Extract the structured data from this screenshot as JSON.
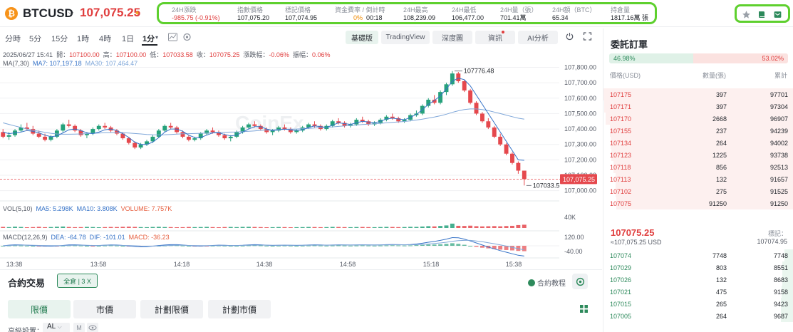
{
  "header": {
    "coin_symbol": "₿",
    "symbol": "BTCUSD",
    "last_price": "107,075.25",
    "stats": [
      {
        "label": "24H漲跌",
        "value": "-985.75 (-0.91%)",
        "tone": "red"
      },
      {
        "label": "指數價格",
        "value": "107,075.20",
        "tone": "normal"
      },
      {
        "label": "標記價格",
        "value": "107,074.95",
        "tone": "normal"
      },
      {
        "label": "資金費率 / 倒計時",
        "value_rate": "0%",
        "value_countdown": "00:18",
        "tone": "mixed"
      },
      {
        "label": "24H最高",
        "value": "108,239.09",
        "tone": "normal"
      },
      {
        "label": "24H最低",
        "value": "106,477.00",
        "tone": "normal"
      },
      {
        "label": "24H量（張）",
        "value": "701.41萬",
        "tone": "normal"
      },
      {
        "label": "24H額（BTC）",
        "value": "65.34",
        "tone": "normal"
      },
      {
        "label": "持倉量",
        "value": "1817.16萬 張",
        "tone": "normal"
      }
    ],
    "icons": [
      "star-icon",
      "book-icon",
      "mail-icon"
    ]
  },
  "toolbar": {
    "timeframes": [
      "分時",
      "5分",
      "15分",
      "1時",
      "4時",
      "1日",
      "1分"
    ],
    "active_timeframe": "1分",
    "views": [
      "基礎版",
      "TradingView",
      "深度圖",
      "資訊",
      "AI分析"
    ],
    "active_view": "基礎版"
  },
  "info": {
    "line1": {
      "date": "2025/06/27 15:41",
      "open_lbl": "開：",
      "open": "107100.00",
      "high_lbl": "高：",
      "high": "107100.00",
      "low_lbl": "低：",
      "low": "107033.58",
      "close_lbl": "收：",
      "close": "107075.25",
      "chg_lbl": "漲跌幅：",
      "chg": "-0.06%",
      "amp_lbl": "振幅：",
      "amp": "0.06%"
    },
    "ma_line": {
      "label": "MA(7,30)",
      "ma7": "MA7: 107,197.18",
      "ma30": "MA30: 107,464.47"
    },
    "vol_line": {
      "label": "VOL(5,10)",
      "ma5": "MA5: 5.298K",
      "ma10": "MA10: 3.808K",
      "volume": "VOLUME: 7.757K"
    },
    "macd_line": {
      "label": "MACD(12,26,9)",
      "dea": "DEA: -64.78",
      "dif": "DIF: -101.01",
      "macd": "MACD: -36.23"
    }
  },
  "chart_data": {
    "type": "candlestick",
    "watermark": "CoinEx",
    "price_axis": [
      "107,800.00",
      "107,700.00",
      "107,600.00",
      "107,500.00",
      "107,400.00",
      "107,300.00",
      "107,200.00",
      "107,100.00",
      "107,000.00"
    ],
    "ylim": [
      106980,
      107830
    ],
    "current_price_tag": "107,075.25",
    "max_label": "107776.48",
    "min_label": "107033.5",
    "volume_axis": [
      "40K"
    ],
    "macd_axis": [
      "120.00",
      "-40.00"
    ],
    "time_axis": [
      "13:38",
      "13:58",
      "14:18",
      "14:38",
      "14:58",
      "15:18",
      "15:38"
    ],
    "colors": {
      "up": "#26a17b",
      "down": "#e5484d",
      "ma7": "#3572c7",
      "ma30": "#7fa7d9",
      "grid": "#f0f1f3",
      "current_line": "#e5484d"
    },
    "candles_ohlc": [
      [
        107380,
        107400,
        107340,
        107350
      ],
      [
        107350,
        107380,
        107330,
        107360
      ],
      [
        107360,
        107400,
        107350,
        107390
      ],
      [
        107390,
        107430,
        107380,
        107410
      ],
      [
        107410,
        107440,
        107390,
        107400
      ],
      [
        107400,
        107420,
        107360,
        107370
      ],
      [
        107370,
        107390,
        107340,
        107350
      ],
      [
        107350,
        107370,
        107320,
        107330
      ],
      [
        107330,
        107360,
        107320,
        107350
      ],
      [
        107350,
        107400,
        107340,
        107390
      ],
      [
        107390,
        107440,
        107380,
        107430
      ],
      [
        107430,
        107460,
        107410,
        107420
      ],
      [
        107420,
        107430,
        107380,
        107390
      ],
      [
        107390,
        107400,
        107350,
        107360
      ],
      [
        107360,
        107380,
        107340,
        107370
      ],
      [
        107370,
        107410,
        107360,
        107400
      ],
      [
        107400,
        107430,
        107390,
        107420
      ],
      [
        107420,
        107440,
        107400,
        107410
      ],
      [
        107410,
        107420,
        107380,
        107390
      ],
      [
        107390,
        107400,
        107360,
        107370
      ],
      [
        107370,
        107380,
        107330,
        107340
      ],
      [
        107340,
        107350,
        107300,
        107310
      ],
      [
        107310,
        107320,
        107270,
        107280
      ],
      [
        107280,
        107310,
        107270,
        107300
      ],
      [
        107300,
        107330,
        107290,
        107320
      ],
      [
        107320,
        107360,
        107310,
        107350
      ],
      [
        107350,
        107400,
        107340,
        107390
      ],
      [
        107390,
        107430,
        107380,
        107420
      ],
      [
        107420,
        107440,
        107400,
        107410
      ],
      [
        107410,
        107420,
        107370,
        107380
      ],
      [
        107380,
        107390,
        107340,
        107350
      ],
      [
        107350,
        107360,
        107320,
        107330
      ],
      [
        107330,
        107350,
        107320,
        107340
      ],
      [
        107340,
        107380,
        107330,
        107370
      ],
      [
        107370,
        107400,
        107360,
        107390
      ],
      [
        107390,
        107410,
        107370,
        107380
      ],
      [
        107380,
        107390,
        107350,
        107360
      ],
      [
        107360,
        107370,
        107330,
        107340
      ],
      [
        107340,
        107360,
        107320,
        107350
      ],
      [
        107350,
        107390,
        107340,
        107380
      ],
      [
        107380,
        107420,
        107370,
        107410
      ],
      [
        107410,
        107440,
        107400,
        107430
      ],
      [
        107430,
        107450,
        107410,
        107420
      ],
      [
        107420,
        107430,
        107390,
        107400
      ],
      [
        107400,
        107410,
        107370,
        107380
      ],
      [
        107380,
        107400,
        107360,
        107390
      ],
      [
        107390,
        107420,
        107380,
        107410
      ],
      [
        107410,
        107430,
        107390,
        107400
      ],
      [
        107400,
        107410,
        107370,
        107380
      ],
      [
        107380,
        107400,
        107370,
        107390
      ],
      [
        107390,
        107420,
        107380,
        107410
      ],
      [
        107410,
        107440,
        107400,
        107430
      ],
      [
        107430,
        107450,
        107410,
        107420
      ],
      [
        107420,
        107430,
        107390,
        107400
      ],
      [
        107400,
        107430,
        107390,
        107420
      ],
      [
        107420,
        107460,
        107410,
        107450
      ],
      [
        107450,
        107470,
        107430,
        107440
      ],
      [
        107440,
        107450,
        107410,
        107420
      ],
      [
        107420,
        107440,
        107410,
        107430
      ],
      [
        107430,
        107470,
        107420,
        107460
      ],
      [
        107460,
        107480,
        107440,
        107450
      ],
      [
        107450,
        107460,
        107420,
        107430
      ],
      [
        107430,
        107450,
        107420,
        107440
      ],
      [
        107440,
        107470,
        107430,
        107460
      ],
      [
        107460,
        107490,
        107450,
        107480
      ],
      [
        107480,
        107500,
        107460,
        107470
      ],
      [
        107470,
        107480,
        107440,
        107450
      ],
      [
        107450,
        107470,
        107440,
        107460
      ],
      [
        107460,
        107500,
        107450,
        107490
      ],
      [
        107490,
        107520,
        107480,
        107500
      ],
      [
        107500,
        107560,
        107490,
        107550
      ],
      [
        107550,
        107600,
        107540,
        107590
      ],
      [
        107590,
        107620,
        107560,
        107570
      ],
      [
        107570,
        107650,
        107560,
        107640
      ],
      [
        107640,
        107700,
        107620,
        107690
      ],
      [
        107690,
        107776,
        107680,
        107760
      ],
      [
        107760,
        107770,
        107700,
        107710
      ],
      [
        107710,
        107720,
        107640,
        107650
      ],
      [
        107650,
        107660,
        107560,
        107570
      ],
      [
        107570,
        107580,
        107490,
        107500
      ],
      [
        107500,
        107510,
        107440,
        107450
      ],
      [
        107450,
        107470,
        107400,
        107410
      ],
      [
        107410,
        107420,
        107340,
        107350
      ],
      [
        107350,
        107370,
        107290,
        107300
      ],
      [
        107300,
        107310,
        107230,
        107240
      ],
      [
        107240,
        107250,
        107170,
        107180
      ],
      [
        107180,
        107190,
        107110,
        107130
      ],
      [
        107130,
        107100,
        107034,
        107075
      ]
    ],
    "ma7": [
      107380,
      107370,
      107375,
      107380,
      107390,
      107385,
      107375,
      107360,
      107350,
      107355,
      107375,
      107395,
      107400,
      107390,
      107375,
      107370,
      107380,
      107395,
      107400,
      107390,
      107370,
      107345,
      107315,
      107300,
      107300,
      107315,
      107345,
      107380,
      107400,
      107400,
      107385,
      107360,
      107345,
      107345,
      107360,
      107375,
      107375,
      107365,
      107355,
      107360,
      107380,
      107400,
      107415,
      107415,
      107400,
      107390,
      107395,
      107400,
      107395,
      107390,
      107395,
      107410,
      107420,
      107415,
      107410,
      107425,
      107440,
      107435,
      107430,
      107440,
      107450,
      107445,
      107440,
      107450,
      107465,
      107470,
      107465,
      107460,
      107475,
      107495,
      107525,
      107560,
      107585,
      107615,
      107660,
      107710,
      107730,
      107720,
      107680,
      107620,
      107560,
      107500,
      107440,
      107380,
      107320,
      107260,
      107200,
      107197
    ],
    "ma30": [
      107440,
      107430,
      107420,
      107410,
      107400,
      107392,
      107385,
      107378,
      107372,
      107368,
      107366,
      107366,
      107367,
      107368,
      107370,
      107372,
      107374,
      107376,
      107377,
      107377,
      107376,
      107374,
      107371,
      107368,
      107365,
      107363,
      107362,
      107363,
      107365,
      107367,
      107369,
      107370,
      107371,
      107372,
      107374,
      107376,
      107378,
      107379,
      107380,
      107381,
      107383,
      107385,
      107388,
      107391,
      107393,
      107394,
      107396,
      107398,
      107399,
      107400,
      107402,
      107404,
      107407,
      107410,
      107412,
      107414,
      107417,
      107420,
      107423,
      107426,
      107429,
      107432,
      107434,
      107437,
      107440,
      107443,
      107446,
      107449,
      107453,
      107458,
      107464,
      107471,
      107478,
      107486,
      107496,
      107508,
      107518,
      107526,
      107530,
      107530,
      107526,
      107519,
      107510,
      107500,
      107490,
      107480,
      107470,
      107464
    ],
    "volume": [
      0.15,
      0.12,
      0.18,
      0.14,
      0.1,
      0.12,
      0.16,
      0.11,
      0.13,
      0.17,
      0.2,
      0.14,
      0.11,
      0.12,
      0.15,
      0.13,
      0.1,
      0.12,
      0.14,
      0.13,
      0.16,
      0.18,
      0.15,
      0.12,
      0.11,
      0.14,
      0.16,
      0.13,
      0.12,
      0.1,
      0.11,
      0.14,
      0.12,
      0.13,
      0.15,
      0.12,
      0.1,
      0.13,
      0.14,
      0.12,
      0.15,
      0.16,
      0.14,
      0.12,
      0.1,
      0.11,
      0.13,
      0.12,
      0.1,
      0.11,
      0.12,
      0.14,
      0.13,
      0.11,
      0.12,
      0.15,
      0.14,
      0.12,
      0.11,
      0.13,
      0.14,
      0.12,
      0.11,
      0.13,
      0.15,
      0.14,
      0.12,
      0.13,
      0.16,
      0.15,
      0.2,
      0.25,
      0.22,
      0.28,
      0.35,
      0.6,
      0.3,
      0.28,
      0.32,
      0.25,
      0.22,
      0.24,
      0.26,
      0.23,
      0.27,
      0.3,
      0.4,
      0.45
    ],
    "macd_hist": [
      0,
      0.02,
      0.03,
      0.02,
      0.01,
      0,
      -0.01,
      -0.02,
      -0.02,
      -0.01,
      0.01,
      0.03,
      0.03,
      0.02,
      0,
      -0.01,
      0,
      0.02,
      0.03,
      0.02,
      0,
      -0.02,
      -0.04,
      -0.05,
      -0.04,
      -0.02,
      0,
      0.02,
      0.04,
      0.04,
      0.02,
      0,
      -0.02,
      -0.02,
      -0.01,
      0.01,
      0.02,
      0.01,
      0,
      0,
      0.01,
      0.03,
      0.04,
      0.03,
      0.01,
      0,
      0.01,
      0.02,
      0.01,
      0,
      0.01,
      0.02,
      0.03,
      0.02,
      0.01,
      0.02,
      0.03,
      0.02,
      0.01,
      0.02,
      0.03,
      0.02,
      0.01,
      0.02,
      0.03,
      0.04,
      0.03,
      0.02,
      0.03,
      0.05,
      0.07,
      0.1,
      0.1,
      0.12,
      0.15,
      0.2,
      0.15,
      0.08,
      0,
      -0.08,
      -0.15,
      -0.2,
      -0.25,
      -0.3,
      -0.33,
      -0.36,
      -0.4,
      -0.42
    ],
    "macd_dif": [
      0,
      0.05,
      0.08,
      0.07,
      0.05,
      0.02,
      0,
      -0.02,
      -0.03,
      -0.01,
      0.03,
      0.07,
      0.08,
      0.06,
      0.03,
      0.01,
      0.02,
      0.05,
      0.07,
      0.06,
      0.03,
      -0.01,
      -0.05,
      -0.08,
      -0.07,
      -0.03,
      0.02,
      0.06,
      0.09,
      0.09,
      0.06,
      0.02,
      -0.01,
      -0.02,
      0,
      0.03,
      0.05,
      0.04,
      0.02,
      0.02,
      0.04,
      0.07,
      0.09,
      0.08,
      0.05,
      0.03,
      0.04,
      0.05,
      0.04,
      0.03,
      0.04,
      0.06,
      0.08,
      0.07,
      0.05,
      0.06,
      0.08,
      0.07,
      0.06,
      0.07,
      0.08,
      0.07,
      0.06,
      0.07,
      0.09,
      0.1,
      0.09,
      0.08,
      0.1,
      0.14,
      0.2,
      0.28,
      0.34,
      0.42,
      0.52,
      0.64,
      0.62,
      0.52,
      0.38,
      0.22,
      0.06,
      -0.1,
      -0.24,
      -0.38,
      -0.5,
      -0.62,
      -0.74,
      -0.8
    ],
    "macd_dea": [
      0,
      0.02,
      0.04,
      0.05,
      0.05,
      0.04,
      0.03,
      0.02,
      0.01,
      0.01,
      0.01,
      0.03,
      0.04,
      0.05,
      0.04,
      0.03,
      0.03,
      0.04,
      0.04,
      0.04,
      0.03,
      0.02,
      0,
      -0.02,
      -0.03,
      -0.02,
      -0.01,
      0.01,
      0.03,
      0.04,
      0.04,
      0.03,
      0.02,
      0.01,
      0.01,
      0.01,
      0.02,
      0.02,
      0.02,
      0.02,
      0.03,
      0.04,
      0.05,
      0.05,
      0.05,
      0.04,
      0.04,
      0.04,
      0.04,
      0.04,
      0.04,
      0.04,
      0.05,
      0.05,
      0.05,
      0.05,
      0.06,
      0.06,
      0.06,
      0.06,
      0.07,
      0.07,
      0.07,
      0.07,
      0.07,
      0.08,
      0.08,
      0.08,
      0.08,
      0.09,
      0.11,
      0.14,
      0.18,
      0.22,
      0.28,
      0.35,
      0.4,
      0.42,
      0.42,
      0.38,
      0.32,
      0.24,
      0.16,
      0.07,
      -0.02,
      -0.12,
      -0.22,
      -0.32
    ]
  },
  "trade": {
    "title": "合約交易",
    "margin_mode": "全倉 | 3 X",
    "tutorial": "合約教程",
    "order_tabs": [
      "限價",
      "市價",
      "計劃限價",
      "計劃市價"
    ],
    "active_tab": "限價",
    "advanced_label": "高級設置：",
    "advanced_value": "AL",
    "advanced_m": "M"
  },
  "orderbook": {
    "title": "委託訂單",
    "buy_ratio": "46.98%",
    "sell_ratio": "53.02%",
    "buy_ratio_value": 0.4698,
    "headers": [
      "價格(USD)",
      "數量(張)",
      "累計"
    ],
    "asks": [
      {
        "price": "107175",
        "qty": "397",
        "total": "97701",
        "depth": 1.0
      },
      {
        "price": "107171",
        "qty": "397",
        "total": "97304",
        "depth": 0.995
      },
      {
        "price": "107170",
        "qty": "2668",
        "total": "96907",
        "depth": 0.99
      },
      {
        "price": "107155",
        "qty": "237",
        "total": "94239",
        "depth": 0.965
      },
      {
        "price": "107134",
        "qty": "264",
        "total": "94002",
        "depth": 0.962
      },
      {
        "price": "107123",
        "qty": "1225",
        "total": "93738",
        "depth": 0.959
      },
      {
        "price": "107118",
        "qty": "856",
        "total": "92513",
        "depth": 0.947
      },
      {
        "price": "107113",
        "qty": "132",
        "total": "91657",
        "depth": 0.938
      },
      {
        "price": "107102",
        "qty": "275",
        "total": "91525",
        "depth": 0.937
      },
      {
        "price": "107075",
        "qty": "91250",
        "total": "91250",
        "depth": 0.934
      }
    ],
    "mid_price": "107075.25",
    "mid_usd": "≈107,075.25  USD",
    "mark_label": "標記：",
    "mark_value": "107074.95",
    "bids": [
      {
        "price": "107074",
        "qty": "7748",
        "total": "7748",
        "depth": 0.05
      },
      {
        "price": "107029",
        "qty": "803",
        "total": "8551",
        "depth": 0.06
      },
      {
        "price": "107026",
        "qty": "132",
        "total": "8683",
        "depth": 0.06
      },
      {
        "price": "107021",
        "qty": "475",
        "total": "9158",
        "depth": 0.065
      },
      {
        "price": "107015",
        "qty": "265",
        "total": "9423",
        "depth": 0.067
      },
      {
        "price": "107005",
        "qty": "264",
        "total": "9687",
        "depth": 0.069
      }
    ]
  }
}
